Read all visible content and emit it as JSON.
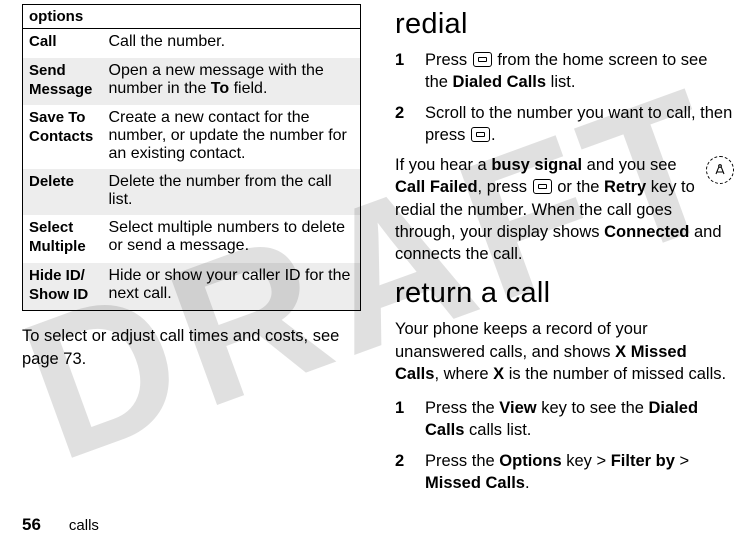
{
  "watermark": "DRAFT",
  "left": {
    "options_header": "options",
    "options": [
      {
        "name": "Call",
        "desc_pre": "Call the number.",
        "cond1": "",
        "desc_mid": "",
        "cond2": "",
        "desc_post": ""
      },
      {
        "name": "Send Message",
        "desc_pre": "Open a new message with the number in the ",
        "cond1": "To",
        "desc_mid": " field.",
        "cond2": "",
        "desc_post": ""
      },
      {
        "name": "Save To Contacts",
        "desc_pre": "Create a new contact for the number, or update the number for an existing contact.",
        "cond1": "",
        "desc_mid": "",
        "cond2": "",
        "desc_post": ""
      },
      {
        "name": "Delete",
        "desc_pre": "Delete the number from the call list.",
        "cond1": "",
        "desc_mid": "",
        "cond2": "",
        "desc_post": ""
      },
      {
        "name": "Select Multiple",
        "desc_pre": "Select multiple numbers to delete or send a message.",
        "cond1": "",
        "desc_mid": "",
        "cond2": "",
        "desc_post": ""
      },
      {
        "name": "Hide ID/ Show ID",
        "desc_pre": "Hide or show your caller ID for the next call.",
        "cond1": "",
        "desc_mid": "",
        "cond2": "",
        "desc_post": ""
      }
    ],
    "after_table": "To select or adjust call times and costs, see page 73."
  },
  "right": {
    "redial": {
      "heading": "redial",
      "steps": [
        {
          "n": "1",
          "pre": "Press ",
          "icon": true,
          "mid": " from the home screen to see the ",
          "cond": "Dialed Calls",
          "post": " list."
        },
        {
          "n": "2",
          "pre": "Scroll to the number you want to call, then press ",
          "icon": true,
          "mid": ".",
          "cond": "",
          "post": ""
        }
      ],
      "busy_para": {
        "t1": "If you hear a ",
        "b1": "busy signal",
        "t2": " and you see ",
        "c1": "Call Failed",
        "t3": ", press ",
        "icon": true,
        "t4": " or the ",
        "c2": "Retry",
        "t5": " key to redial the number. When the call goes through, your display shows ",
        "c3": "Connected",
        "t6": " and connects the call."
      }
    },
    "return": {
      "heading": "return a call",
      "intro": {
        "t1": "Your phone keeps a record of your unanswered calls, and shows ",
        "c1": "X Missed Calls",
        "t2": ", where ",
        "c2": "X",
        "t3": " is the number of missed calls."
      },
      "steps": [
        {
          "n": "1",
          "t1": "Press the ",
          "c1": "View",
          "t2": " key to see the ",
          "c2": "Dialed Calls",
          "t3": " calls list."
        },
        {
          "n": "2",
          "t1": "Press the ",
          "c1": "Options",
          "t2": " key > ",
          "c2": "Filter by",
          "t3": " > ",
          "c3": "Missed Calls",
          "t4": "."
        }
      ]
    }
  },
  "footer": {
    "page": "56",
    "section": "calls"
  }
}
